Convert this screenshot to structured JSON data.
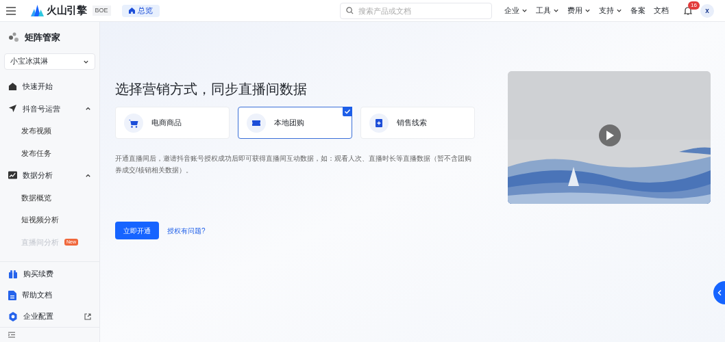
{
  "header": {
    "logo_text": "火山引擎",
    "env_badge": "BOE",
    "home_tab": "总览",
    "search": {
      "placeholder": "搜索产品或文档"
    },
    "nav": [
      {
        "label": "企业",
        "dropdown": true
      },
      {
        "label": "工具",
        "dropdown": true
      },
      {
        "label": "费用",
        "dropdown": true
      },
      {
        "label": "支持",
        "dropdown": true
      },
      {
        "label": "备案",
        "dropdown": false
      },
      {
        "label": "文档",
        "dropdown": false
      }
    ],
    "notifications": "16",
    "avatar": "x"
  },
  "sidebar": {
    "title": "矩阵管家",
    "account": "小宝冰淇淋",
    "items": [
      {
        "label": "快速开始"
      },
      {
        "label": "抖音号运营",
        "expanded": true,
        "children": [
          {
            "label": "发布视频",
            "disabled": false
          },
          {
            "label": "发布任务",
            "disabled": false
          }
        ]
      },
      {
        "label": "数据分析",
        "expanded": true,
        "children": [
          {
            "label": "数据概览",
            "disabled": false
          },
          {
            "label": "短视频分析",
            "disabled": false
          },
          {
            "label": "直播间分析",
            "disabled": true,
            "badge": "New"
          }
        ]
      }
    ],
    "bottom_items": [
      {
        "label": "购买续费",
        "external": false
      },
      {
        "label": "帮助文档",
        "external": false
      },
      {
        "label": "企业配置",
        "external": true
      }
    ]
  },
  "main": {
    "title": "选择营销方式，同步直播间数据",
    "options": [
      {
        "label": "电商商品",
        "selected": false
      },
      {
        "label": "本地团购",
        "selected": true
      },
      {
        "label": "销售线索",
        "selected": false
      }
    ],
    "description": "开通直播间后，邀请抖音账号授权成功后即可获得直播间互动数据，如：观看人次、直播时长等直播数据（暂不含团购券成交/核销相关数据）。",
    "primary_button": "立即开通",
    "help_link": "授权有问题?"
  }
}
